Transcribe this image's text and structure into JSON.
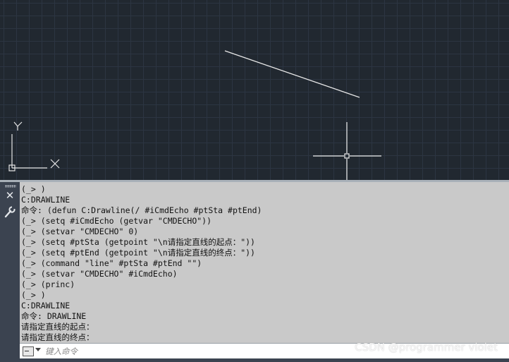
{
  "canvas": {
    "ucs_y_label": "Y",
    "ucs_x_label": "X",
    "background_color": "#212830",
    "line_color": "#ffffff"
  },
  "command_window": {
    "lines": [
      "(_> )",
      "C:DRAWLINE",
      "命令: (defun C:Drawline(/ #iCmdEcho #ptSta #ptEnd)",
      "(_> (setq #iCmdEcho (getvar \"CMDECHO\"))",
      "(_> (setvar \"CMDECHO\" 0)",
      "(_> (setq #ptSta (getpoint \"\\n请指定直线的起点：\"))",
      "(_> (setq #ptEnd (getpoint \"\\n请指定直线的终点：\"))",
      "(_> (command \"line\" #ptSta #ptEnd \"\")",
      "(_> (setvar \"CMDECHO\" #iCmdEcho)",
      "(_> (princ)",
      "(_> )",
      "C:DRAWLINE",
      "命令: DRAWLINE",
      "请指定直线的起点：",
      "请指定直线的终点："
    ],
    "input_placeholder": "键入命令",
    "close_icon": "close-icon",
    "customize_icon": "wrench-icon"
  },
  "watermark": "CSDN @programmer violet"
}
